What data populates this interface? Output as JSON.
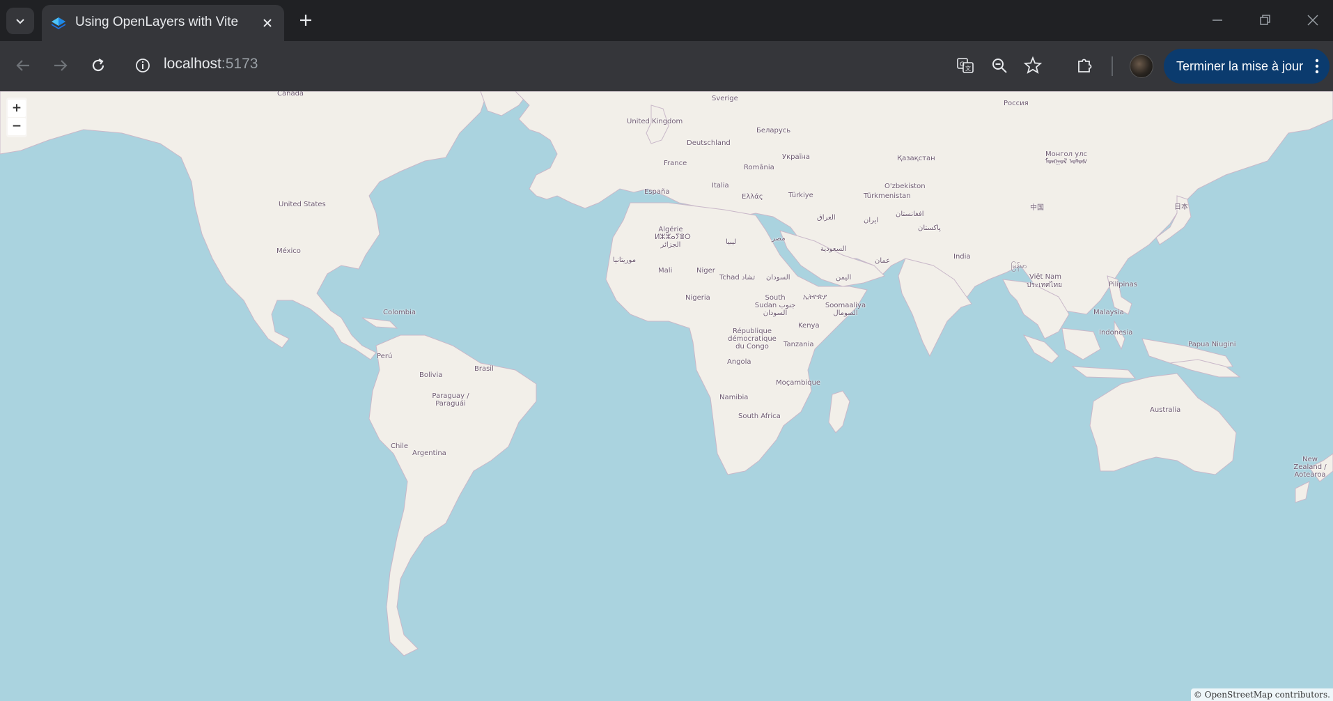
{
  "tab": {
    "title": "Using OpenLayers with Vite"
  },
  "address": {
    "host": "localhost",
    "port": ":5173"
  },
  "toolbar": {
    "update_button": "Terminer la mise à jour"
  },
  "map": {
    "zoom_in": "+",
    "zoom_out": "−",
    "attribution": "© OpenStreetMap contributors.",
    "labels": [
      "Canada",
      "Sverige",
      "Россия",
      "United Kingdom",
      "Беларусь",
      "Deutschland",
      "Україна",
      "France",
      "România",
      "Қазақстан",
      "Монгол улс ᠮᠣᠩᠭᠣᠯ ᠤᠯᠤᠰ",
      "España",
      "Italia",
      "Ελλάς",
      "Türkiye",
      "O'zbekiston",
      "Türkmenistan",
      "United States",
      "中国",
      "日本",
      "Algérie ⵍⵣⵣⴰⵢⴻⵔ الجزائر",
      "ليبيا",
      "مصر",
      "العراق",
      "ایران",
      "افغانستان",
      "پاکستان",
      "México",
      "السعودية",
      "India",
      "موريتانيا",
      "Mali",
      "Niger",
      "Tchad تشاد",
      "السودان",
      "عمان",
      "اليمن",
      "မြန်မာ",
      "Việt Nam",
      "Pilipinas",
      "ประเทศไทย",
      "Nigeria",
      "South Sudan جنوب السودان",
      "ኢትዮጵያ",
      "Soomaaliya الصومال",
      "Colombia",
      "Malaysia",
      "Kenya",
      "République démocratique du Congo",
      "Indonesia",
      "Papua Niugini",
      "Tanzania",
      "Perú",
      "Brasil",
      "Angola",
      "Bolivia",
      "Moçambique",
      "Paraguay / Paraguái",
      "Namibia",
      "Australia",
      "South Africa",
      "Chile",
      "Argentina",
      "New Zealand / Aotearoa"
    ]
  },
  "colors": {
    "water": "#aad3df",
    "land": "#f2efe9",
    "border": "#b9a8b9",
    "accent": "#0b3b6e"
  }
}
